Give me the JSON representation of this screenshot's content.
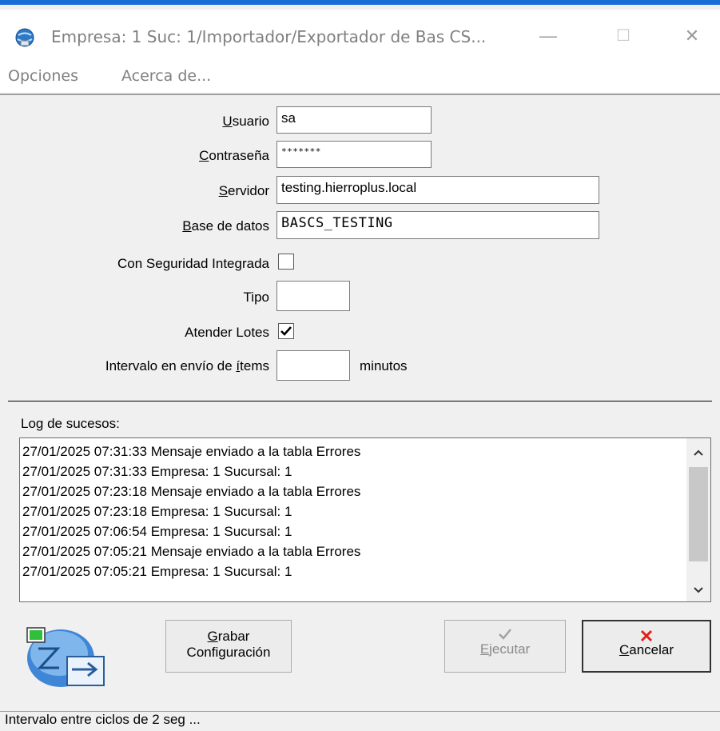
{
  "window": {
    "title": "Empresa: 1 Suc: 1/Importador/Exportador de Bas CS...",
    "minimize": "—",
    "maximize": "☐",
    "close": "✕"
  },
  "menu": {
    "items": [
      "Opciones",
      "Acerca de..."
    ]
  },
  "form": {
    "usuario_label_u": "U",
    "usuario_label_rest": "suario",
    "usuario_value": "sa",
    "contrasena_label_u": "C",
    "contrasena_label_rest": "ontraseña",
    "contrasena_value": "*******",
    "servidor_label_u": "S",
    "servidor_label_rest": "ervidor",
    "servidor_value": "testing.hierroplus.local",
    "base_label_u": "B",
    "base_label_rest": "ase de datos",
    "base_value": "BASCS_TESTING",
    "seguridad_label": "Con Seguridad Integrada",
    "seguridad_checked": false,
    "tipo_label": "Tipo",
    "tipo_value": "",
    "lotes_label": "Atender Lotes",
    "lotes_checked": true,
    "intervalo_label_pre": "Intervalo en envío de ",
    "intervalo_label_u": "í",
    "intervalo_label_post": "tems",
    "intervalo_value": "",
    "intervalo_unit": "minutos"
  },
  "log": {
    "label": "Log de sucesos:",
    "lines": [
      "27/01/2025 07:31:33 Mensaje enviado a la tabla Errores",
      "27/01/2025 07:31:33 Empresa: 1 Sucursal: 1",
      "27/01/2025 07:23:18 Mensaje enviado a la tabla Errores",
      "27/01/2025 07:23:18 Empresa: 1 Sucursal: 1",
      "27/01/2025 07:06:54 Empresa: 1 Sucursal: 1",
      "27/01/2025 07:05:21 Mensaje enviado a la tabla Errores",
      "27/01/2025 07:05:21 Empresa: 1 Sucursal: 1"
    ]
  },
  "buttons": {
    "grabar_u": "G",
    "grabar_rest": "rabar",
    "grabar_line2": "Configuración",
    "ejecutar_u": "E",
    "ejecutar_rest": "jecutar",
    "cancelar_u": "C",
    "cancelar_rest": "ancelar"
  },
  "status": {
    "text": "Intervalo entre ciclos de 2 seg ..."
  },
  "colors": {
    "titlebar_accent": "#1a6fd6",
    "cancel_x": "#e0201a",
    "window_bg": "#f0f0f0"
  }
}
